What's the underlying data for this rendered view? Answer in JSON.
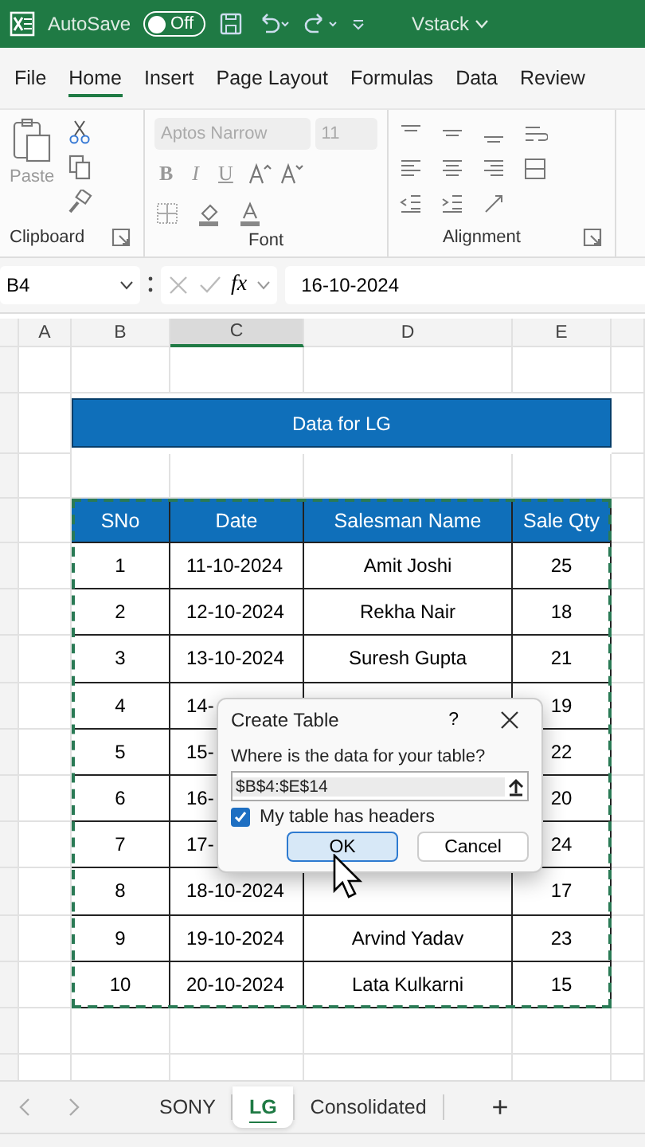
{
  "title_bar": {
    "autosave_label": "AutoSave",
    "autosave_toggle": {
      "label": "Off",
      "on": false
    },
    "file_name": "Vstack"
  },
  "ribbon_tabs": [
    {
      "label": "File",
      "selected": false
    },
    {
      "label": "Home",
      "selected": true
    },
    {
      "label": "Insert",
      "selected": false
    },
    {
      "label": "Page Layout",
      "selected": false
    },
    {
      "label": "Formulas",
      "selected": false
    },
    {
      "label": "Data",
      "selected": false
    },
    {
      "label": "Review",
      "selected": false
    }
  ],
  "ribbon": {
    "paste_label": "Paste",
    "font_name": "Aptos Narrow",
    "font_size": "11",
    "style_buttons": [
      "B",
      "I",
      "U"
    ],
    "groups": [
      "Clipboard",
      "Font",
      "Alignment"
    ]
  },
  "formula_bar": {
    "name_box": "B4",
    "fx": "fx",
    "value": "16-10-2024"
  },
  "columns": [
    {
      "label": "A",
      "selected": false
    },
    {
      "label": "B",
      "selected": false
    },
    {
      "label": "C",
      "selected": true
    },
    {
      "label": "D",
      "selected": false
    },
    {
      "label": "E",
      "selected": false
    }
  ],
  "sheet": {
    "title": "Data for LG",
    "table": {
      "columns": [
        "SNo",
        "Date",
        "Salesman Name",
        "Sale Qty"
      ],
      "rows": [
        [
          "1",
          "11-10-2024",
          "Amit Joshi",
          "25"
        ],
        [
          "2",
          "12-10-2024",
          "Rekha Nair",
          "18"
        ],
        [
          "3",
          "13-10-2024",
          "Suresh Gupta",
          "21"
        ],
        [
          "4",
          "14-",
          "",
          "19"
        ],
        [
          "5",
          "15-",
          "",
          "22"
        ],
        [
          "6",
          "16-",
          "",
          "20"
        ],
        [
          "7",
          "17-",
          "",
          "24"
        ],
        [
          "8",
          "18-10-2024",
          "",
          "17"
        ],
        [
          "9",
          "19-10-2024",
          "Arvind Yadav",
          "23"
        ],
        [
          "10",
          "20-10-2024",
          "Lata Kulkarni",
          "15"
        ]
      ]
    }
  },
  "dialog": {
    "title": "Create Table",
    "help": "?",
    "prompt": "Where is the data for your table?",
    "range": "$B$4:$E$14",
    "headers_label": "My table has headers",
    "headers_checked": true,
    "ok": "OK",
    "cancel": "Cancel"
  },
  "sheet_tabs": [
    {
      "label": "SONY",
      "selected": false
    },
    {
      "label": "LG",
      "selected": true
    },
    {
      "label": "Consolidated",
      "selected": false
    }
  ],
  "add_sheet": "+"
}
